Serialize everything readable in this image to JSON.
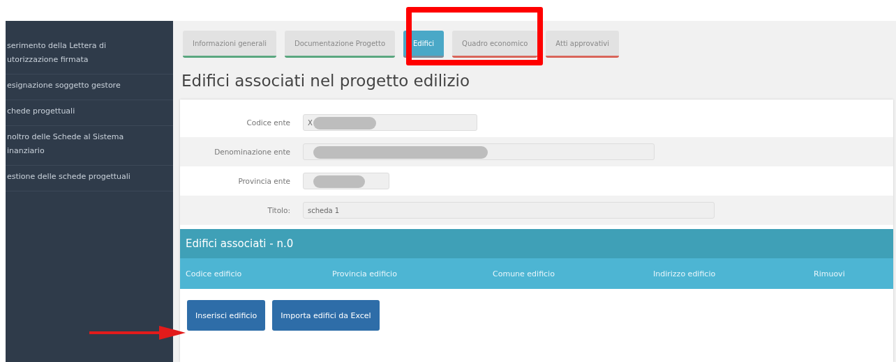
{
  "sidebar": {
    "items": [
      {
        "label": "serimento della Lettera di utorizzazione firmata"
      },
      {
        "label": "esignazione soggetto gestore"
      },
      {
        "label": "chede progettuali"
      },
      {
        "label": "noltro delle Schede al Sistema inanziario"
      },
      {
        "label": "estione delle schede progettuali"
      }
    ]
  },
  "tabs": [
    {
      "label": "Informazioni generali",
      "selected": false,
      "color": "#5aa77f"
    },
    {
      "label": "Documentazione Progetto",
      "selected": false,
      "color": "#5aa77f"
    },
    {
      "label": "Edifici",
      "selected": true,
      "color": "#7f8c9a"
    },
    {
      "label": "Quadro economico",
      "selected": false,
      "color": "#d9655a"
    },
    {
      "label": "Atti approvativi",
      "selected": false,
      "color": "#d9655a"
    }
  ],
  "heading": "Edifici associati nel progetto edilizio",
  "form": [
    {
      "label": "Codice ente",
      "value": "X",
      "redacted": true
    },
    {
      "label": "Denominazione ente",
      "redacted": true
    },
    {
      "label": "Provincia ente",
      "redacted": true
    },
    {
      "label": "Titolo:",
      "value": "scheda 1",
      "redacted": false
    }
  ],
  "table": {
    "title": "Edifici associati - n.0",
    "columns": [
      "Codice edificio",
      "Provincia edificio",
      "Comune edificio",
      "Indirizzo edificio",
      "Rimuovi"
    ]
  },
  "buttons": [
    "Inserisci edificio",
    "Importa edifici da Excel"
  ]
}
